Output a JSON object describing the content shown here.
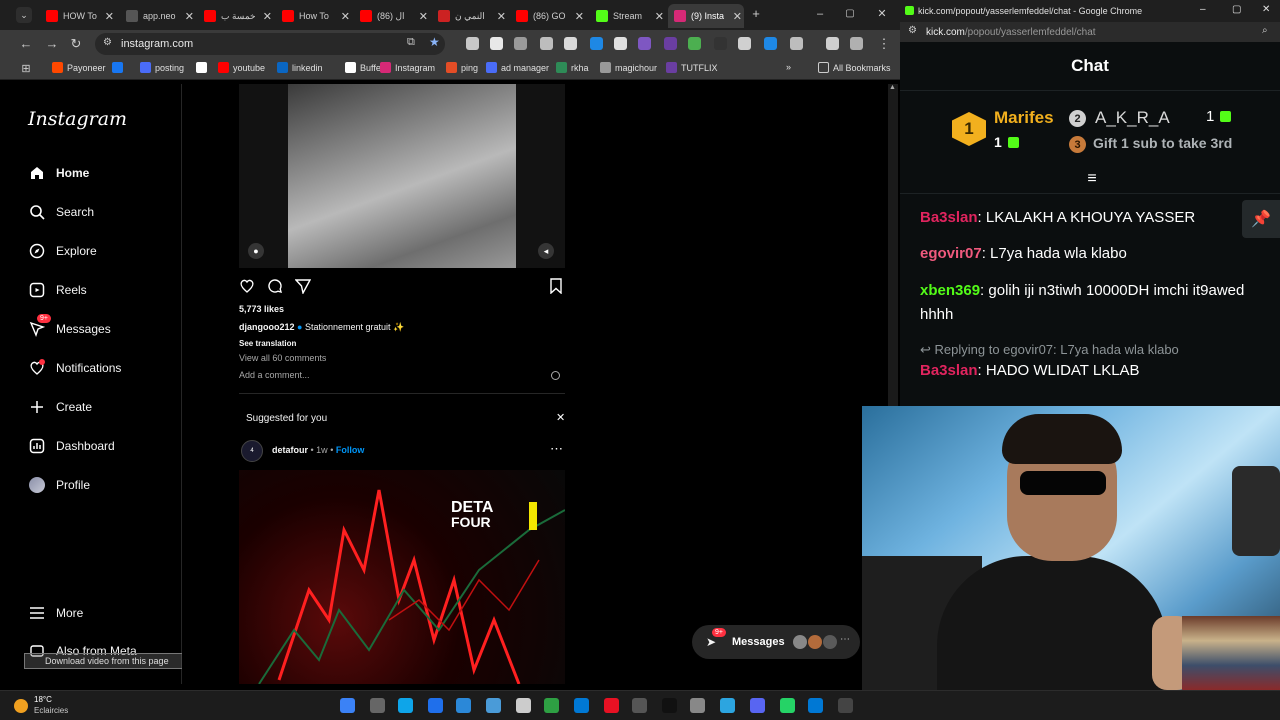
{
  "browser_left": {
    "tabs": [
      {
        "label": "HOW To",
        "color": "#ff0000"
      },
      {
        "label": "app.neo",
        "color": "#555555"
      },
      {
        "label": "خمسة ب",
        "color": "#ff0000"
      },
      {
        "label": "How To",
        "color": "#ff0000"
      },
      {
        "label": "(86) ال",
        "color": "#ff0000"
      },
      {
        "label": "النمي ن",
        "color": "#cc2222"
      },
      {
        "label": "(86) GO",
        "color": "#ff0000"
      },
      {
        "label": "Stream",
        "color": "#53fc18"
      },
      {
        "label": "(9) Insta",
        "color": "#d62976"
      }
    ],
    "url": "instagram.com",
    "bookmarks": [
      {
        "label": "Payoneer",
        "color": "#ff4800"
      },
      {
        "label": "",
        "color": "#1877f2"
      },
      {
        "label": "posting",
        "color": "#4a6cf7"
      },
      {
        "label": "",
        "color": "#ffffff"
      },
      {
        "label": "youtube",
        "color": "#ff0000"
      },
      {
        "label": "linkedin",
        "color": "#0a66c2"
      },
      {
        "label": "Buffer",
        "color": "#ffffff"
      },
      {
        "label": "Instagram",
        "color": "#d62976"
      },
      {
        "label": "ping",
        "color": "#e44d26"
      },
      {
        "label": "ad manager",
        "color": "#4a6cf7"
      },
      {
        "label": "rkha",
        "color": "#2e8b57"
      },
      {
        "label": "magichour",
        "color": "#999999"
      },
      {
        "label": "TUTFLIX",
        "color": "#6a3ea1"
      }
    ],
    "all_bookmarks": "All Bookmarks"
  },
  "instagram": {
    "logo": "Instagram",
    "nav": [
      {
        "label": "Home",
        "icon": "home-icon"
      },
      {
        "label": "Search",
        "icon": "search-icon"
      },
      {
        "label": "Explore",
        "icon": "compass-icon"
      },
      {
        "label": "Reels",
        "icon": "reels-icon"
      },
      {
        "label": "Messages",
        "icon": "messenger-icon",
        "badge": "9+"
      },
      {
        "label": "Notifications",
        "icon": "heart-icon"
      },
      {
        "label": "Create",
        "icon": "plus-icon"
      },
      {
        "label": "Dashboard",
        "icon": "dashboard-icon"
      },
      {
        "label": "Profile",
        "icon": "avatar-icon"
      }
    ],
    "more": "More",
    "also_from_meta": "Also from Meta",
    "download_bar": "Download video from this page",
    "post": {
      "likes": "5,773 likes",
      "username": "djangooo212",
      "caption": "Stationnement gratuit ✨",
      "see_translation": "See translation",
      "view_comments": "View all 60 comments",
      "add_comment_placeholder": "Add a comment..."
    },
    "suggested": {
      "title": "Suggested for you",
      "username": "detafour",
      "time": "1w",
      "follow": "Follow",
      "image_text_1": "DETA",
      "image_text_2": "FOUR"
    },
    "messages_bar": {
      "label": "Messages",
      "badge": "9+"
    }
  },
  "browser_right": {
    "title": "kick.com/popout/yasserlemfeddel/chat - Google Chrome",
    "url_host": "kick.com",
    "url_path": "/popout/yasserlemfeddel/chat",
    "chat_title": "Chat",
    "leaderboard": {
      "first_rank": "1",
      "first_name": "Marifes",
      "first_count": "1",
      "second_rank": "2",
      "second_name": "A_K_R_A",
      "second_count": "1",
      "third_rank": "3",
      "third_text": "Gift 1 sub to take 3rd"
    },
    "messages": [
      {
        "user": "Ba3slan",
        "color": "#e0245e",
        "text": "LKALAKH A KHOUYA YASSER"
      },
      {
        "user": "egovir07",
        "color": "#f05a7e",
        "text": "L7ya hada wla klabo"
      },
      {
        "user": "xben369",
        "color": "#53fc18",
        "text": "golih iji n3tiwh 10000DH imchi it9awed hhhh"
      }
    ],
    "reply_context": "Replying to egovir07: L7ya hada wla klabo",
    "reply": {
      "user": "Ba3slan",
      "color": "#e0245e",
      "text": "HADO WLIDAT LKLAB"
    }
  },
  "taskbar": {
    "temperature": "18°C",
    "weather": "Eclaircies"
  }
}
